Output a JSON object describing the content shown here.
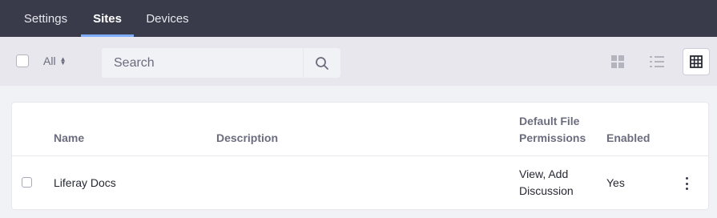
{
  "nav": {
    "tabs": [
      {
        "label": "Settings",
        "active": false
      },
      {
        "label": "Sites",
        "active": true
      },
      {
        "label": "Devices",
        "active": false
      }
    ]
  },
  "toolbar": {
    "filter_label": "All",
    "search_placeholder": "Search",
    "views": [
      "cards-view-icon",
      "list-view-icon",
      "table-view-icon"
    ],
    "active_view": "table-view-icon"
  },
  "table": {
    "headers": {
      "name": "Name",
      "description": "Description",
      "permissions_line1": "Default File",
      "permissions_line2": "Permissions",
      "enabled": "Enabled"
    },
    "rows": [
      {
        "name": "Liferay Docs",
        "description": "",
        "permissions_line1": "View, Add",
        "permissions_line2": "Discussion",
        "enabled": "Yes"
      }
    ]
  },
  "colors": {
    "nav_bg": "#393a4a",
    "active_tab_underline": "#80acff",
    "toolbar_bg": "#e7e7ed",
    "page_bg": "#f1f2f5"
  }
}
